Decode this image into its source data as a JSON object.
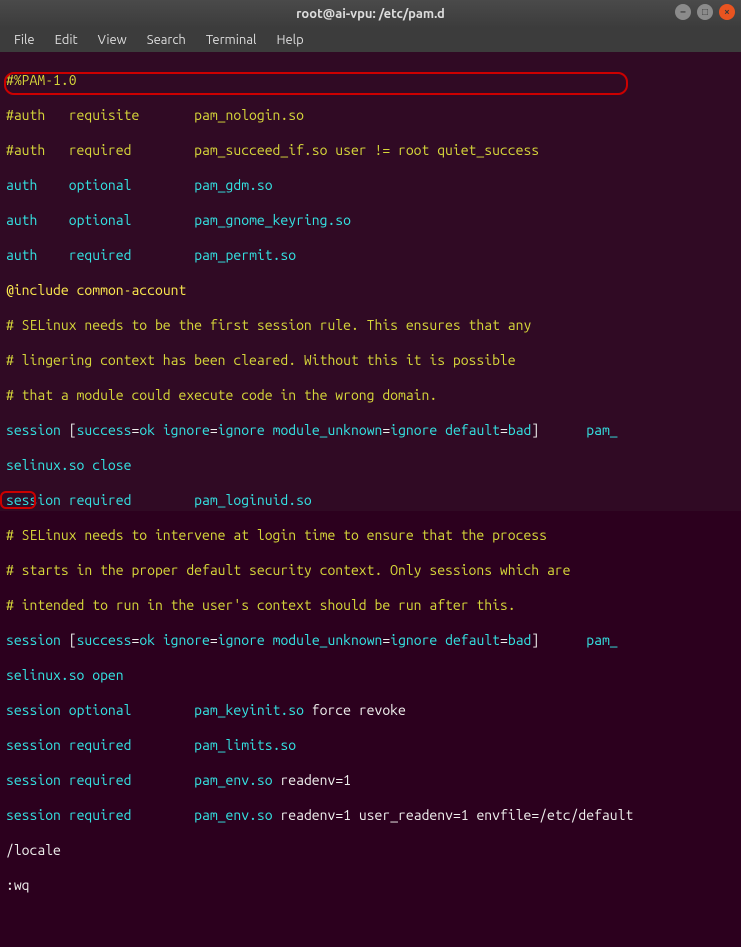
{
  "titlebar": {
    "title": "root@ai-vpu: /etc/pam.d"
  },
  "menubar": {
    "file": "File",
    "edit": "Edit",
    "view": "View",
    "search": "Search",
    "terminal": "Terminal",
    "help": "Help"
  },
  "win_controls": {
    "min_glyph": "–",
    "max_glyph": "□",
    "close_glyph": "×"
  },
  "lines": {
    "l00": "#%PAM-1.0",
    "l01a": "#auth   requisite       pam_nologin.so",
    "l02a": "#auth   required        pam_succeed_if.so user != root quiet_success",
    "l03a": "auth",
    "l03b": "    optional        ",
    "l03c": "pam_gdm.so",
    "l04a": "auth",
    "l04b": "    optional        ",
    "l04c": "pam_gnome_keyring.so",
    "l05a": "auth",
    "l05b": "    required        ",
    "l05c": "pam_permit.so",
    "l06a": "@include",
    "l06b": " ",
    "l06c": "common-account",
    "l07": "# SELinux needs to be the first session rule. This ensures that any",
    "l08": "# lingering context has been cleared. Without this it is possible",
    "l09": "# that a module could execute code in the wrong domain.",
    "l10a": "session",
    "l10b": " [",
    "l10c": "success",
    "l10d": "=",
    "l10e": "ok",
    "l10f": " ",
    "l10g": "ignore",
    "l10h": "=",
    "l10i": "ignore",
    "l10j": " ",
    "l10k": "module_unknown",
    "l10l": "=",
    "l10m": "ignore",
    "l10n": " ",
    "l10o": "default",
    "l10p": "=",
    "l10q": "bad",
    "l10r": "]",
    "l10s": "      pam_",
    "l11a": "selinux.so",
    "l11b": " ",
    "l11c": "close",
    "l12a": "session",
    "l12b": " required        ",
    "l12c": "pam_loginuid.so",
    "l13": "# SELinux needs to intervene at login time to ensure that the process",
    "l14": "# starts in the proper default security context. Only sessions which are",
    "l15": "# intended to run in the user's context should be run after this.",
    "l16a": "session",
    "l16b": " [",
    "l16c": "success",
    "l16d": "=",
    "l16e": "ok",
    "l16f": " ",
    "l16g": "ignore",
    "l16h": "=",
    "l16i": "ignore",
    "l16j": " ",
    "l16k": "module_unknown",
    "l16l": "=",
    "l16m": "ignore",
    "l16n": " ",
    "l16o": "default",
    "l16p": "=",
    "l16q": "bad",
    "l16r": "]",
    "l16s": "      pam_",
    "l17a": "selinux.so",
    "l17b": " ",
    "l17c": "open",
    "l18a": "session",
    "l18b": " optional        ",
    "l18c": "pam_keyinit.so",
    "l18d": " force revoke",
    "l19a": "session",
    "l19b": " required        ",
    "l19c": "pam_limits.so",
    "l20a": "session",
    "l20b": " required        ",
    "l20c": "pam_env.so",
    "l20d": " ",
    "l20e": "readenv",
    "l20f": "=",
    "l20g": "1",
    "l21a": "session",
    "l21b": " required        ",
    "l21c": "pam_env.so",
    "l21d": " ",
    "l21e": "readenv",
    "l21f": "=",
    "l21g": "1",
    "l21h": " ",
    "l21i": "user_readenv",
    "l21j": "=",
    "l21k": "1",
    "l21l": " ",
    "l21m": "envfile",
    "l21n": "=",
    "l21o": "/etc/default",
    "l22": "/locale",
    "l23": ":wq"
  }
}
